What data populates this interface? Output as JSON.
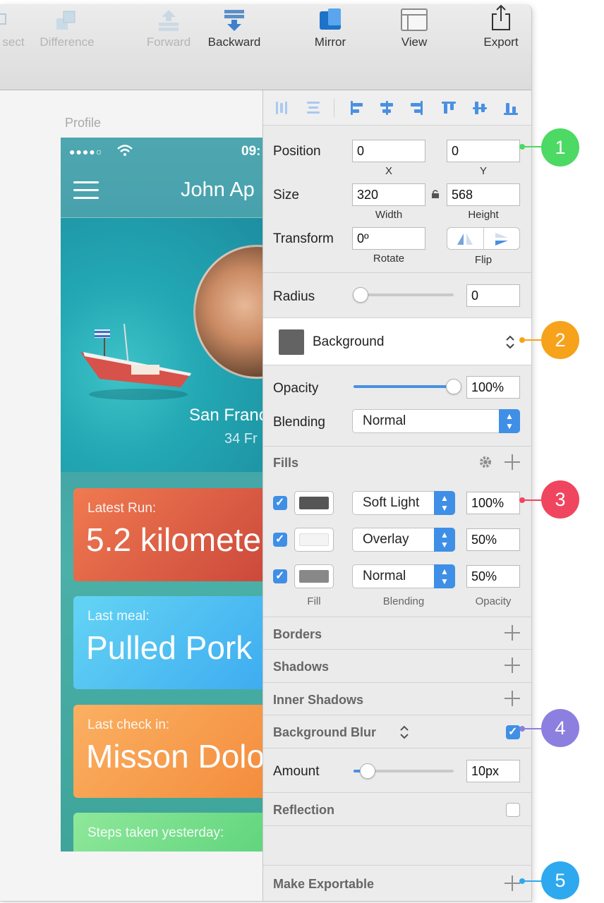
{
  "toolbar": {
    "items": [
      {
        "label": "sect",
        "icon": "intersect-icon",
        "dim": true
      },
      {
        "label": "Difference",
        "icon": "difference-icon",
        "dim": true
      },
      {
        "label": "Forward",
        "icon": "forward-icon",
        "dim": true
      },
      {
        "label": "Backward",
        "icon": "backward-icon",
        "dim": false
      },
      {
        "label": "Mirror",
        "icon": "mirror-icon",
        "dim": false
      },
      {
        "label": "View",
        "icon": "view-icon",
        "dim": false
      },
      {
        "label": "Export",
        "icon": "export-icon",
        "dim": false
      }
    ]
  },
  "canvas": {
    "artboard_label": "Profile",
    "phone": {
      "status_dots": "●●●●○",
      "clock": "09:",
      "name": "John Ap",
      "city": "San Franc",
      "distance": "34 Fr",
      "cards": [
        {
          "caption": "Latest Run:",
          "value": "5.2 kilomete"
        },
        {
          "caption": "Last meal:",
          "value": "Pulled Pork"
        },
        {
          "caption": "Last check in:",
          "value": "Misson Dolo"
        },
        {
          "caption": "Steps taken yesterday:",
          "value": ""
        }
      ]
    }
  },
  "inspector": {
    "position": {
      "label": "Position",
      "x": "0",
      "y": "0",
      "x_label": "X",
      "y_label": "Y"
    },
    "size": {
      "label": "Size",
      "width": "320",
      "height": "568",
      "width_label": "Width",
      "height_label": "Height"
    },
    "transform": {
      "label": "Transform",
      "rotate": "0º",
      "rotate_label": "Rotate",
      "flip_label": "Flip"
    },
    "radius": {
      "label": "Radius",
      "value": "0"
    },
    "style": {
      "name": "Background",
      "swatch_color": "#636363"
    },
    "opacity": {
      "label": "Opacity",
      "value": "100%",
      "level": 1.0
    },
    "blending": {
      "label": "Blending",
      "value": "Normal"
    },
    "fills": {
      "title": "Fills",
      "rows": [
        {
          "checked": true,
          "blend": "Soft Light",
          "opacity": "100%",
          "swatch": "#555555"
        },
        {
          "checked": true,
          "blend": "Overlay",
          "opacity": "50%",
          "swatch": "#f4f4f4"
        },
        {
          "checked": true,
          "blend": "Normal",
          "opacity": "50%",
          "swatch": "#888888"
        }
      ],
      "col_fill": "Fill",
      "col_blending": "Blending",
      "col_opacity": "Opacity"
    },
    "borders": "Borders",
    "shadows": "Shadows",
    "inner_shadows": "Inner Shadows",
    "background_blur": {
      "label": "Background Blur",
      "checked": true
    },
    "amount": {
      "label": "Amount",
      "value": "10px",
      "level": 0.14
    },
    "reflection": {
      "label": "Reflection",
      "checked": false
    },
    "make_exportable": "Make Exportable"
  },
  "callouts": [
    {
      "number": "1",
      "color": "#4cd964"
    },
    {
      "number": "2",
      "color": "#f7a21b"
    },
    {
      "number": "3",
      "color": "#f0455f"
    },
    {
      "number": "4",
      "color": "#8d7fe0"
    },
    {
      "number": "5",
      "color": "#2ea8ee"
    }
  ]
}
